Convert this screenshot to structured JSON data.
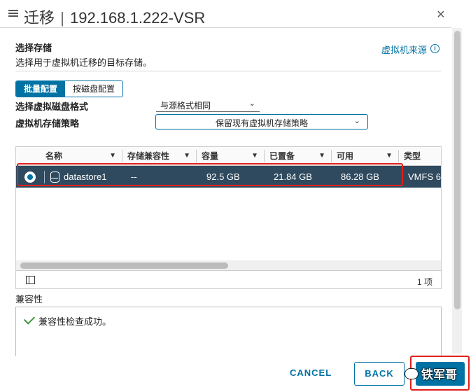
{
  "header": {
    "title_main": "迁移",
    "title_sep": "|",
    "title_target": "192.168.1.222-VSR",
    "close": "×"
  },
  "section": {
    "title": "选择存储",
    "subtitle": "选择用于虚拟机迁移的目标存储。",
    "source_link": "虚拟机来源",
    "info": "i"
  },
  "config_tabs": [
    {
      "label": "批量配置",
      "selected": true
    },
    {
      "label": "按磁盘配置",
      "selected": false
    }
  ],
  "form": {
    "disk_format_label": "选择虚拟磁盘格式",
    "disk_format_value": "与源格式相同",
    "policy_label": "虚拟机存储策略",
    "policy_value": "保留现有虚拟机存储策略",
    "chevron": "⌄"
  },
  "grid": {
    "columns": [
      "名称",
      "存储兼容性",
      "容量",
      "已置备",
      "可用",
      "类型"
    ],
    "filter_glyph": "▼",
    "rows": [
      {
        "name": "datastore1",
        "compat": "--",
        "capacity": "92.5 GB",
        "provisioned": "21.84 GB",
        "free": "86.28 GB",
        "type": "VMFS 6",
        "selected": true
      }
    ],
    "item_count": "1 项"
  },
  "compatibility": {
    "label": "兼容性",
    "message": "兼容性检查成功。"
  },
  "footer": {
    "cancel": "CANCEL",
    "back": "BACK",
    "next": ""
  },
  "watermark": "铁军哥",
  "colors": {
    "accent": "#0072a3",
    "selected_row": "#2f4a5e",
    "highlight": "#e0201c",
    "success": "#3a9a3a"
  }
}
